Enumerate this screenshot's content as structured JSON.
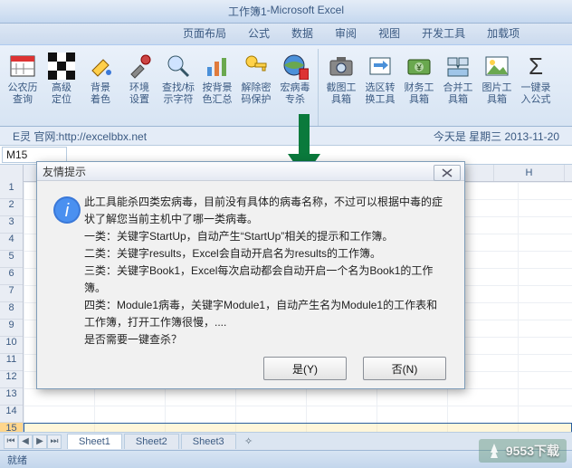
{
  "title": {
    "doc": "工作簿1",
    "sep": " - ",
    "app": "Microsoft Excel"
  },
  "tabs": {
    "t1": "页面布局",
    "t2": "公式",
    "t3": "数据",
    "t4": "审阅",
    "t5": "视图",
    "t6": "开发工具",
    "t7": "加载项"
  },
  "ribbon": {
    "b1": "公农历\n查询",
    "b2": "高级\n定位",
    "b3": "背景\n着色",
    "b4": "环境\n设置",
    "b5": "查找/标\n示字符",
    "b6": "按背景\n色汇总",
    "b7": "解除密\n码保护",
    "b8": "宏病毒\n专杀",
    "b9": "截图工\n具箱",
    "b10": "选区转\n换工具",
    "b11": "财务工\n具箱",
    "b12": "合并工\n具箱",
    "b13": "图片工\n具箱",
    "b14": "一键录\n入公式"
  },
  "info": {
    "left": "E灵 官网:http://excelbbx.net",
    "right": "今天是  星期三  2013-11-20"
  },
  "namebox": "M15",
  "colhdr": {
    "h": "H"
  },
  "rows": [
    "1",
    "2",
    "3",
    "4",
    "5",
    "6",
    "7",
    "8",
    "9",
    "10",
    "11",
    "12",
    "13",
    "14",
    "15"
  ],
  "dialog": {
    "title": "友情提示",
    "l1": "此工具能杀四类宏病毒，目前没有具体的病毒名称，不过可以根据中毒的症状了解您当前主机中了哪一类病毒。",
    "l2": "一类：关键字StartUp，自动产生“StartUp”相关的提示和工作簿。",
    "l3": "二类：关键字results，Excel会自动开启名为results的工作簿。",
    "l4": "三类：关键字Book1，Excel每次启动都会自动开启一个名为Book1的工作簿。",
    "l5": "四类：Module1病毒，关键字Module1，自动产生名为Module1的工作表和工作簿，打开工作簿很慢，....",
    "l6": "是否需要一键查杀？",
    "yes": "是(Y)",
    "no": "否(N)"
  },
  "sheets": {
    "s1": "Sheet1",
    "s2": "Sheet2",
    "s3": "Sheet3"
  },
  "status": {
    "ready": "就绪",
    "wm": "9553下载"
  }
}
